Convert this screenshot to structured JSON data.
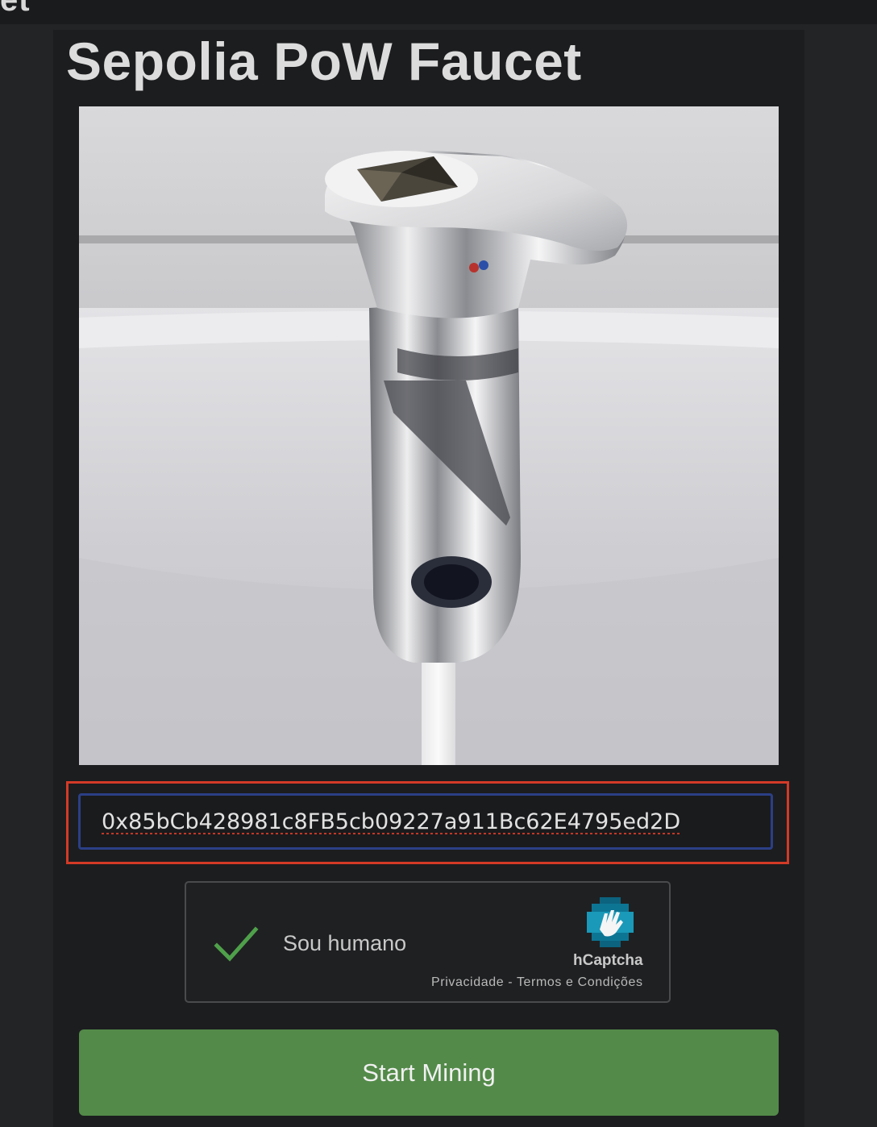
{
  "topbar": {
    "title_fragment": "et"
  },
  "page": {
    "title": "Sepolia PoW Faucet"
  },
  "hero_image": {
    "description_icon": "faucet-with-ethereum-logo-image"
  },
  "address_field": {
    "value": "0x85bCb428981c8FB5cb09227a911Bc62E4795ed2D",
    "highlight_color": "#d33a27"
  },
  "captcha": {
    "label": "Sou humano",
    "brand": "hCaptcha",
    "privacy_link": "Privacidade",
    "separator": " - ",
    "terms_link": "Termos e Condições",
    "checked": true,
    "check_color": "#4fa04a"
  },
  "actions": {
    "start_mining_label": "Start Mining",
    "button_color": "#538a49"
  },
  "colors": {
    "background": "#232426",
    "panel": "#1c1d1f",
    "input_border": "#2b3f86"
  }
}
